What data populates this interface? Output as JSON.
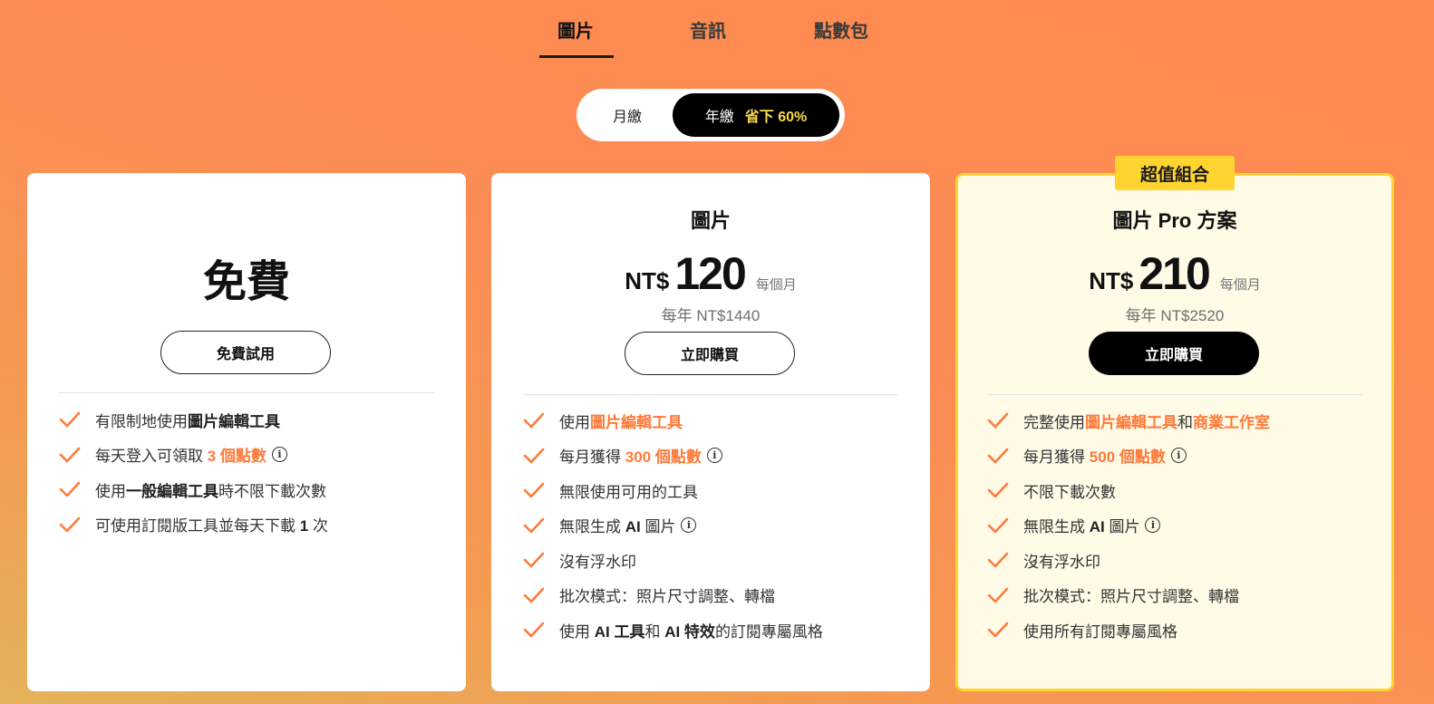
{
  "tabs": [
    {
      "label": "圖片",
      "active": true
    },
    {
      "label": "音訊",
      "active": false
    },
    {
      "label": "點數包",
      "active": false
    }
  ],
  "billing": {
    "monthly": "月繳",
    "yearly": "年繳",
    "save": "省下 60%",
    "selected": "yearly"
  },
  "colors": {
    "accent": "#ff7a3a",
    "badge": "#ffd330",
    "save_text": "#ffd84a",
    "pro_card_bg": "#fffbe7"
  },
  "icons": {
    "check": "check-icon",
    "info": "info-icon"
  },
  "plans": {
    "free": {
      "title": "免費",
      "button": "免費試用",
      "features": {
        "f1": {
          "a": "有限制地使用",
          "b": "圖片編輯工具"
        },
        "f2": {
          "a": "每天登入可領取 ",
          "hl": "3 個點數"
        },
        "f3": {
          "a": "使用",
          "b": "一般編輯工具",
          "c": "時不限下載次數"
        },
        "f4": {
          "a": "可使用訂閱版工具並每天下載 ",
          "b": "1",
          "c": " 次"
        }
      }
    },
    "image": {
      "title": "圖片",
      "currency": "NT$",
      "price": "120",
      "per": "每個月",
      "yearly": "每年 NT$1440",
      "button": "立即購買",
      "features": {
        "f1": {
          "a": "使用",
          "hl": "圖片編輯工具"
        },
        "f2": {
          "a": "每月獲得 ",
          "hl": "300 個點數"
        },
        "f3": "無限使用可用的工具",
        "f4": {
          "a": "無限生成 ",
          "b": "AI",
          "c": " 圖片"
        },
        "f5": "沒有浮水印",
        "f6": "批次模式：照片尺寸調整、轉檔",
        "f7": {
          "a": "使用 ",
          "b": "AI 工具",
          "c": "和 ",
          "d": "AI 特效",
          "e": "的訂閱專屬風格"
        }
      }
    },
    "pro": {
      "badge": "超值組合",
      "title": "圖片 Pro 方案",
      "currency": "NT$",
      "price": "210",
      "per": "每個月",
      "yearly": "每年 NT$2520",
      "button": "立即購買",
      "features": {
        "f1": {
          "a": "完整使用",
          "hl1": "圖片編輯工具",
          "b": "和",
          "hl2": "商業工作室"
        },
        "f2": {
          "a": "每月獲得 ",
          "hl": "500 個點數"
        },
        "f3": "不限下載次數",
        "f4": {
          "a": "無限生成 ",
          "b": "AI",
          "c": " 圖片"
        },
        "f5": "沒有浮水印",
        "f6": "批次模式：照片尺寸調整、轉檔",
        "f7": "使用所有訂閱專屬風格"
      }
    }
  }
}
